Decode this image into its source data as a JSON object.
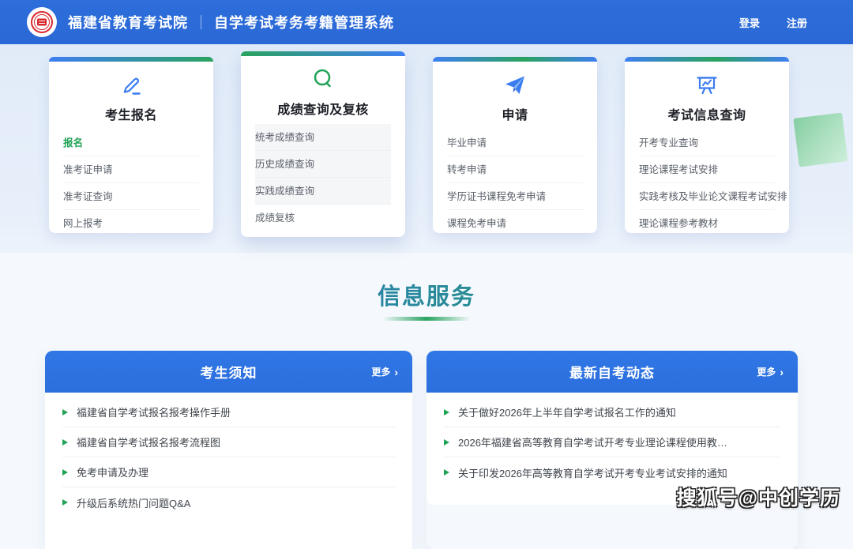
{
  "header": {
    "org_name": "福建省教育考试院",
    "system_name": "自学考试考务考籍管理系统",
    "login_label": "登录",
    "register_label": "注册"
  },
  "cards": [
    {
      "title": "考生报名",
      "icon": "pencil-icon",
      "items": [
        {
          "label": "报名",
          "active": true
        },
        {
          "label": "准考证申请"
        },
        {
          "label": "准考证查询"
        },
        {
          "label": "网上报考"
        }
      ]
    },
    {
      "title": "成绩查询及复核",
      "icon": "search-icon",
      "items": [
        {
          "label": "统考成绩查询"
        },
        {
          "label": "历史成绩查询"
        },
        {
          "label": "实践成绩查询"
        },
        {
          "label": "成绩复核"
        }
      ]
    },
    {
      "title": "申请",
      "icon": "paper-plane-icon",
      "items": [
        {
          "label": "毕业申请"
        },
        {
          "label": "转考申请"
        },
        {
          "label": "学历证书课程免考申请"
        },
        {
          "label": "课程免考申请"
        }
      ]
    },
    {
      "title": "考试信息查询",
      "icon": "presentation-chart-icon",
      "items": [
        {
          "label": "开考专业查询"
        },
        {
          "label": "理论课程考试安排"
        },
        {
          "label": "实践考核及毕业论文课程考试安排"
        },
        {
          "label": "理论课程参考教材"
        }
      ]
    }
  ],
  "info_section": {
    "title": "信息服务",
    "more_label": "更多",
    "more_chevron": "›",
    "panels": [
      {
        "title": "考生须知",
        "items": [
          "福建省自学考试报名报考操作手册",
          "福建省自学考试报名报考流程图",
          "免考申请及办理",
          "升级后系统热门问题Q&A"
        ]
      },
      {
        "title": "最新自考动态",
        "items": [
          "关于做好2026年上半年自学考试报名工作的通知",
          "2026年福建省高等教育自学考试开考专业理论课程使用教…",
          "关于印发2026年高等教育自学考试开考专业考试安排的通知"
        ]
      }
    ]
  },
  "watermark": "搜狐号@中创学历",
  "colors": {
    "header_blue": "#2b6bd8",
    "panel_header_blue": "#2e72e0",
    "accent_green": "#21a356",
    "accent_blue": "#3b7cf0",
    "card_bar_blue": "#3d7ef2",
    "card_bar_green": "#2aa35f"
  }
}
